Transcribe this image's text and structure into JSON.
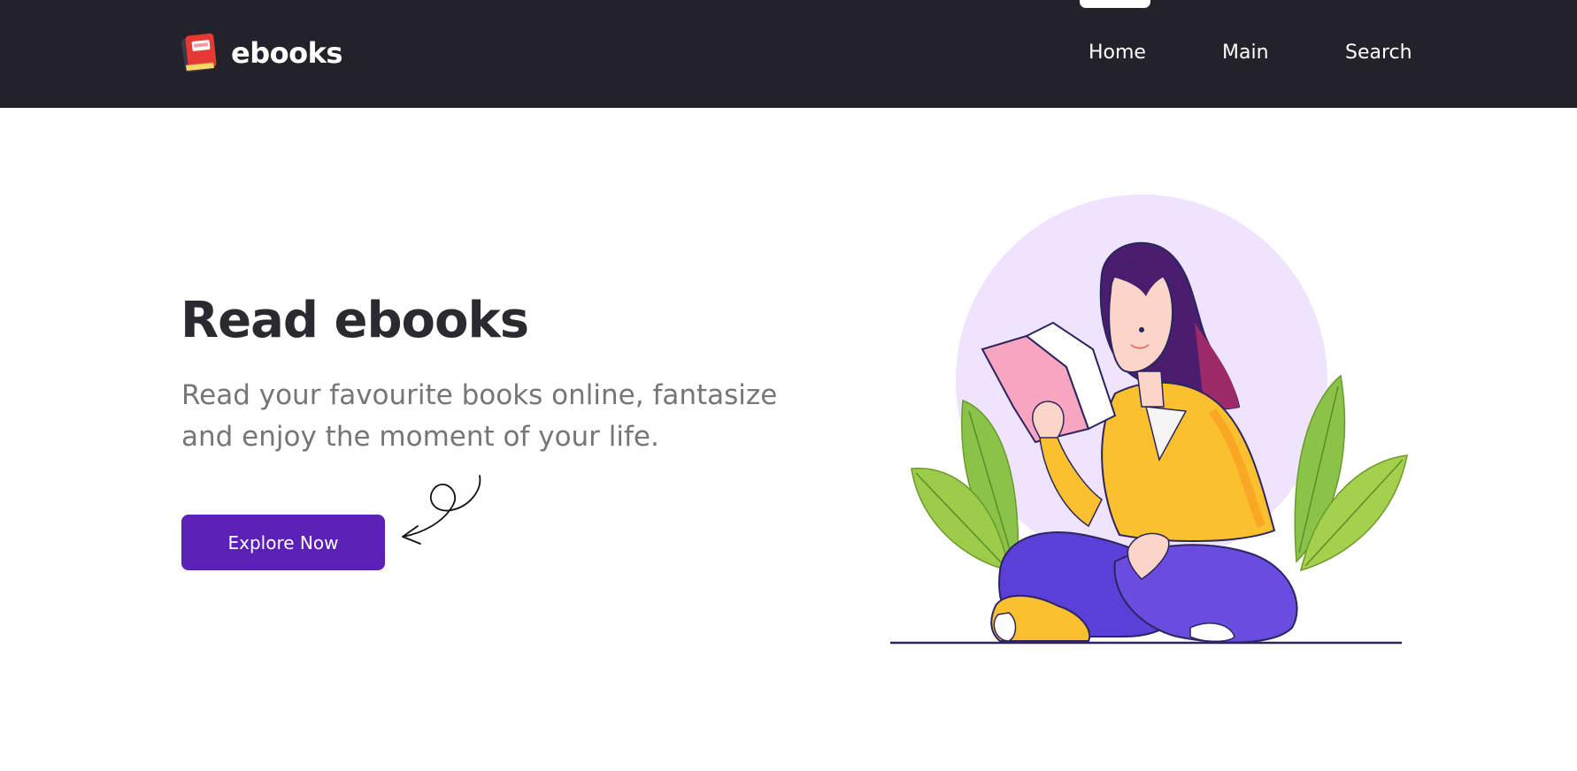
{
  "brand": {
    "name": "ebooks",
    "icon": "red-book-icon"
  },
  "nav": {
    "links": [
      "Home",
      "Main",
      "Search"
    ],
    "active": "Home"
  },
  "hero": {
    "title": "Read ebooks",
    "subtitle": "Read your favourite books online, fantasize and enjoy the moment of your life.",
    "cta_label": "Explore Now"
  },
  "colors": {
    "navbar_bg": "#23222b",
    "accent": "#5b21b6",
    "title_text": "#2a2a30",
    "subtitle_text": "#75757a",
    "illustration_circle": "#efe3fd"
  }
}
